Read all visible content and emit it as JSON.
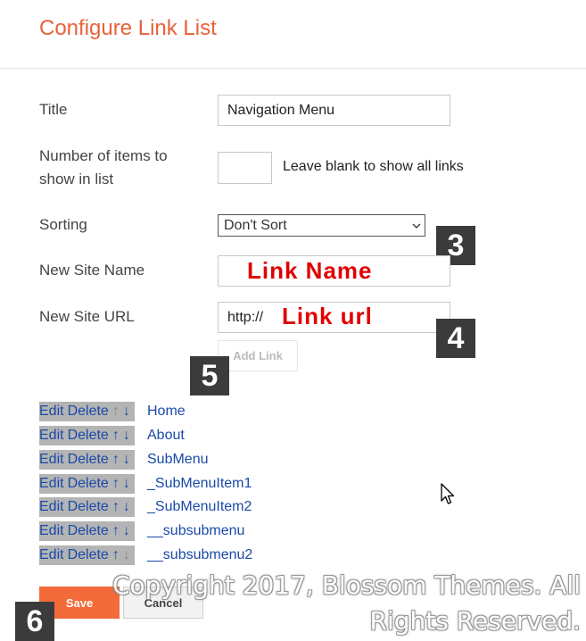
{
  "page": {
    "title": "Configure Link List"
  },
  "form": {
    "title_label": "Title",
    "title_value": "Navigation Menu",
    "count_label_line1": "Number of items to",
    "count_label_line2": "show in list",
    "count_value": "",
    "count_hint": "Leave blank to show all links",
    "sorting_label": "Sorting",
    "sorting_value": "Don't Sort",
    "site_name_label": "New Site Name",
    "site_name_value": "",
    "site_url_label": "New Site URL",
    "site_url_value": "http://",
    "add_link_label": "Add Link"
  },
  "overlays": {
    "link_name": "Link Name",
    "link_url": "Link url",
    "badge3": "3",
    "badge4": "4",
    "badge5": "5",
    "badge6": "6"
  },
  "links": [
    {
      "edit": "Edit",
      "delete": "Delete",
      "up": "↑",
      "down": "↓",
      "name": "Home"
    },
    {
      "edit": "Edit",
      "delete": "Delete",
      "up": "↑",
      "down": "↓",
      "name": "About"
    },
    {
      "edit": "Edit",
      "delete": "Delete",
      "up": "↑",
      "down": "↓",
      "name": "SubMenu"
    },
    {
      "edit": "Edit",
      "delete": "Delete",
      "up": "↑",
      "down": "↓",
      "name": "_SubMenuItem1"
    },
    {
      "edit": "Edit",
      "delete": "Delete",
      "up": "↑",
      "down": "↓",
      "name": "_SubMenuItem2"
    },
    {
      "edit": "Edit",
      "delete": "Delete",
      "up": "↑",
      "down": "↓",
      "name": "__subsubmenu"
    },
    {
      "edit": "Edit",
      "delete": "Delete",
      "up": "↑",
      "down": "↓",
      "name": "__subsubmenu2"
    }
  ],
  "buttons": {
    "save": "Save",
    "cancel": "Cancel"
  },
  "watermark": {
    "line1": "Copyright 2017, Blossom Themes. All",
    "line2": "Rights Reserved."
  },
  "colors": {
    "accent": "#e8613a",
    "save_bg": "#f26b38",
    "link": "#1a4aa8",
    "badge": "#3b3b3b",
    "overlay_red": "#e00000"
  }
}
